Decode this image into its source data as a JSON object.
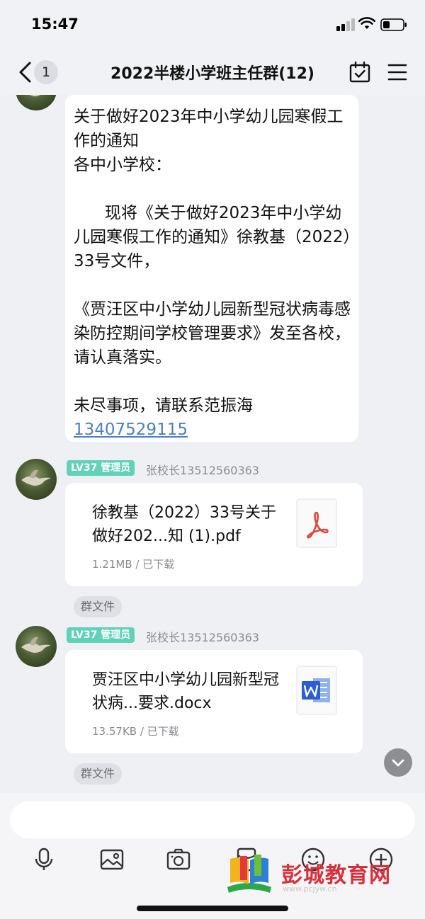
{
  "status_bar": {
    "time": "15:47"
  },
  "nav": {
    "unread_count": "1",
    "title": "2022半楼小学班主任群(12)"
  },
  "messages": [
    {
      "type": "text",
      "body": "关于做好2023年中小学幼儿园寒假工作的通知\n各中小学校：\n\n      现将《关于做好2023年中小学幼儿园寒假工作的通知》徐教基（2022）33号文件，\n\n《贾汪区中小学幼儿园新型冠状病毒感染防控期间学校管理要求》发至各校，请认真落实。\n\n未尽事项，请联系范振海",
      "phone": "13407529115"
    },
    {
      "type": "file",
      "level": "LV37 管理员",
      "sender": "张校长13512560363",
      "file_name": "徐教基（2022）33号关于做好202...知 (1).pdf",
      "file_meta": "1.21MB / 已下载",
      "file_icon": "pdf-icon",
      "tag": "群文件"
    },
    {
      "type": "file",
      "level": "LV37 管理员",
      "sender": "张校长13512560363",
      "file_name": "贾汪区中小学幼儿园新型冠状病...要求.docx",
      "file_meta": "13.57KB / 已下载",
      "file_icon": "word-icon",
      "tag": "群文件"
    }
  ],
  "input": {
    "placeholder": ""
  },
  "toolbar": {
    "icons": [
      "microphone-icon",
      "image-icon",
      "camera-icon",
      "red-packet-icon",
      "emoji-icon",
      "plus-icon"
    ]
  },
  "watermark": {
    "text": "彭城教育网",
    "url": "www.pcjyw.cn"
  },
  "colors": {
    "accent_badge": "#5fd2b8",
    "link": "#4c7fc4",
    "pdf_red": "#e2463a",
    "word_blue": "#2b5ed1",
    "watermark_red": "#d8303b"
  }
}
